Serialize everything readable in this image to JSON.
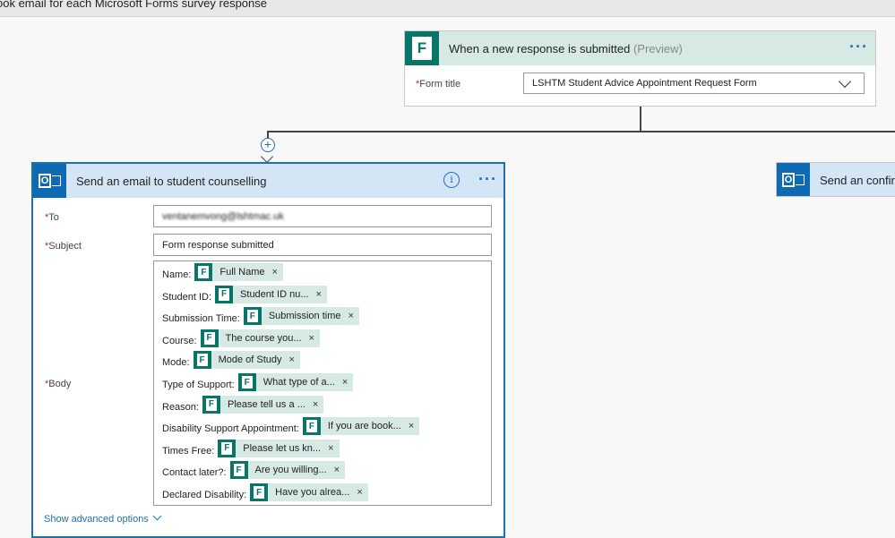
{
  "header": {
    "title": "ook email for each Microsoft Forms survey response"
  },
  "trigger": {
    "title": "When a new response is submitted",
    "preview": "(Preview)",
    "more": "···",
    "form_label_req": "*",
    "form_label": "Form title",
    "form_value": "LSHTM Student Advice Appointment Request Form"
  },
  "action": {
    "title": "Send an email to student counselling",
    "info": "i",
    "more": "···",
    "to_req": "*",
    "to_label": "To",
    "to_value": "ventanemvong@lshtmac.uk",
    "subject_req": "*",
    "subject_label": "Subject",
    "subject_value": "Form response submitted",
    "body_req": "*",
    "body_label": "Body",
    "body_rows": [
      {
        "label": "Name:",
        "token": "Full Name"
      },
      {
        "label": "Student ID:",
        "token": "Student ID nu..."
      },
      {
        "label": "Submission Time:",
        "token": "Submission time"
      },
      {
        "label": "Course:",
        "token": "The course you..."
      },
      {
        "label": "Mode:",
        "token": "Mode of Study"
      },
      {
        "label": "Type of Support:",
        "token": "What type of a..."
      },
      {
        "label": "Reason:",
        "token": "Please tell us a ..."
      },
      {
        "label": "Disability Support Appointment:",
        "token": "If you are book..."
      },
      {
        "label": "Times Free:",
        "token": "Please let us kn..."
      },
      {
        "label": "Contact later?:",
        "token": "Are you willing..."
      },
      {
        "label": "Declared Disability:",
        "token": "Have you alrea..."
      }
    ],
    "advanced": "Show advanced options"
  },
  "side_action": {
    "title": "Send an confirm"
  },
  "icons": {
    "forms": "forms-icon",
    "outlook": "outlook-icon",
    "add": "add-step-icon"
  },
  "colors": {
    "forms_green": "#077568",
    "outlook_blue": "#0f6ab4",
    "accent": "#1e6fb5"
  }
}
